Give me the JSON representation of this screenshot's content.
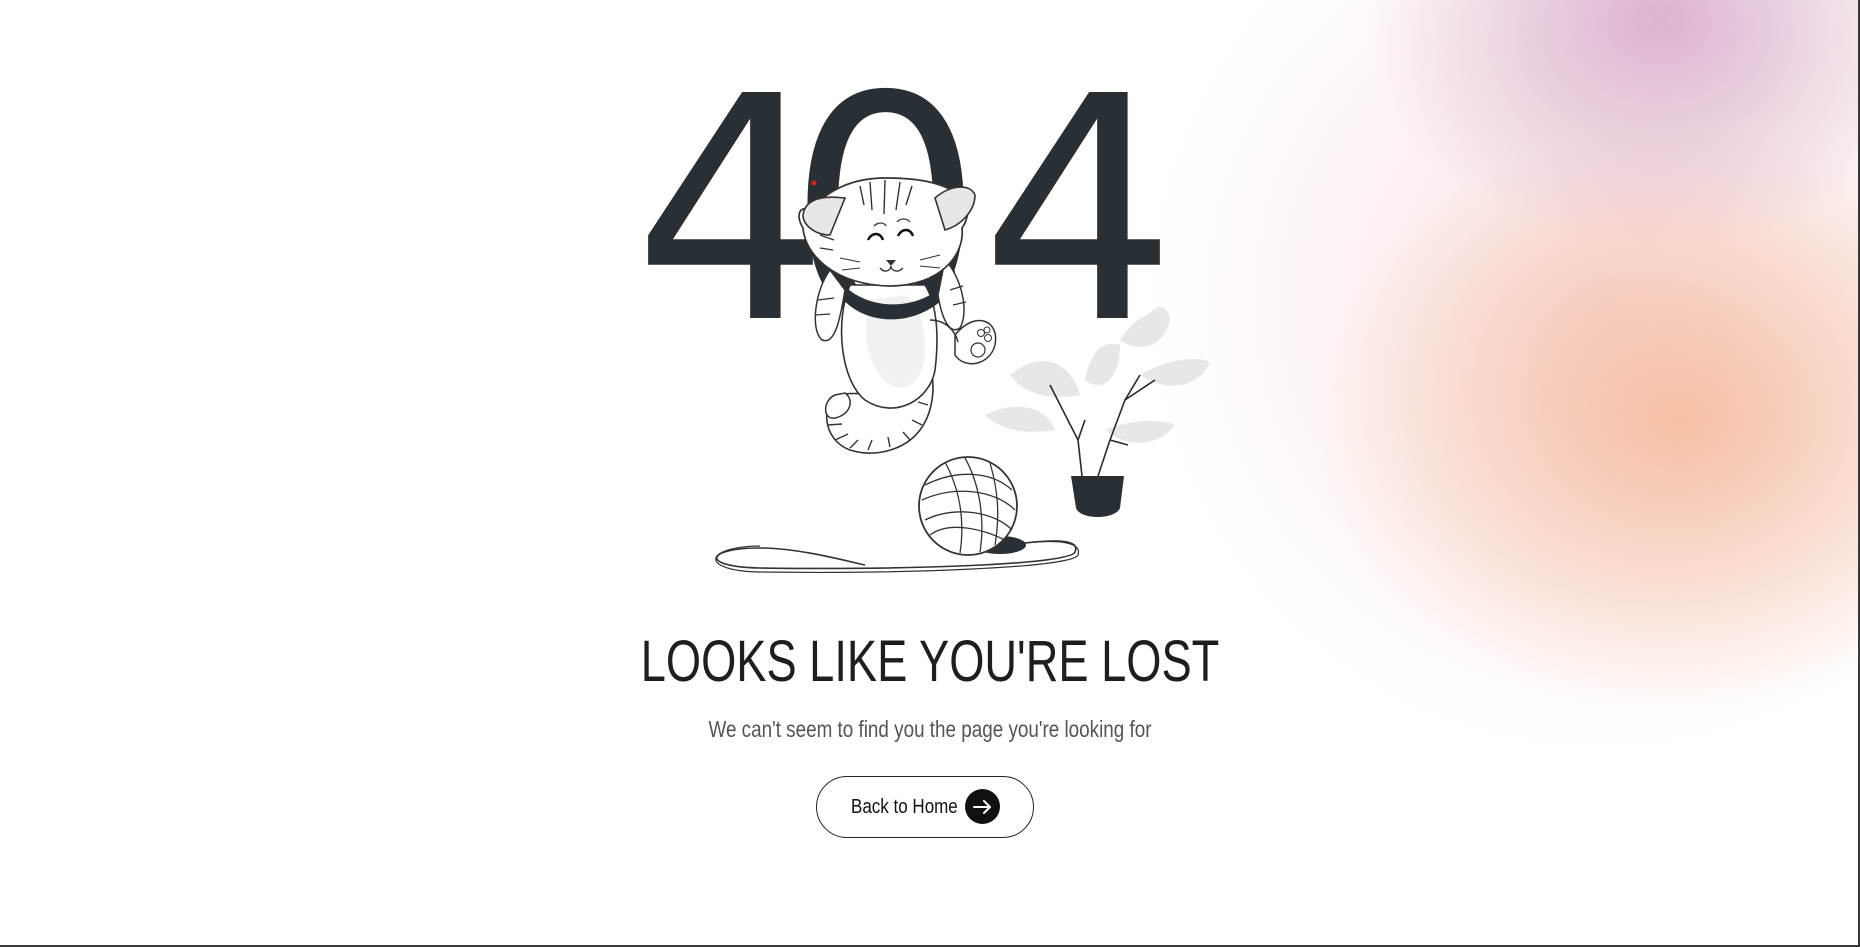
{
  "error": {
    "digit_left": "4",
    "digit_middle": "0",
    "digit_right": "4"
  },
  "heading": "LOOKS LIKE YOU'RE LOST",
  "subtext": "We can't seem to find you the page you're looking for",
  "home_button": {
    "label": "Back to Home",
    "icon": "arrow-right-icon"
  },
  "colors": {
    "digits": "#283036",
    "accent_pink": "#d6a8c8",
    "accent_peach": "#f4b08c",
    "button_border": "#222222"
  }
}
